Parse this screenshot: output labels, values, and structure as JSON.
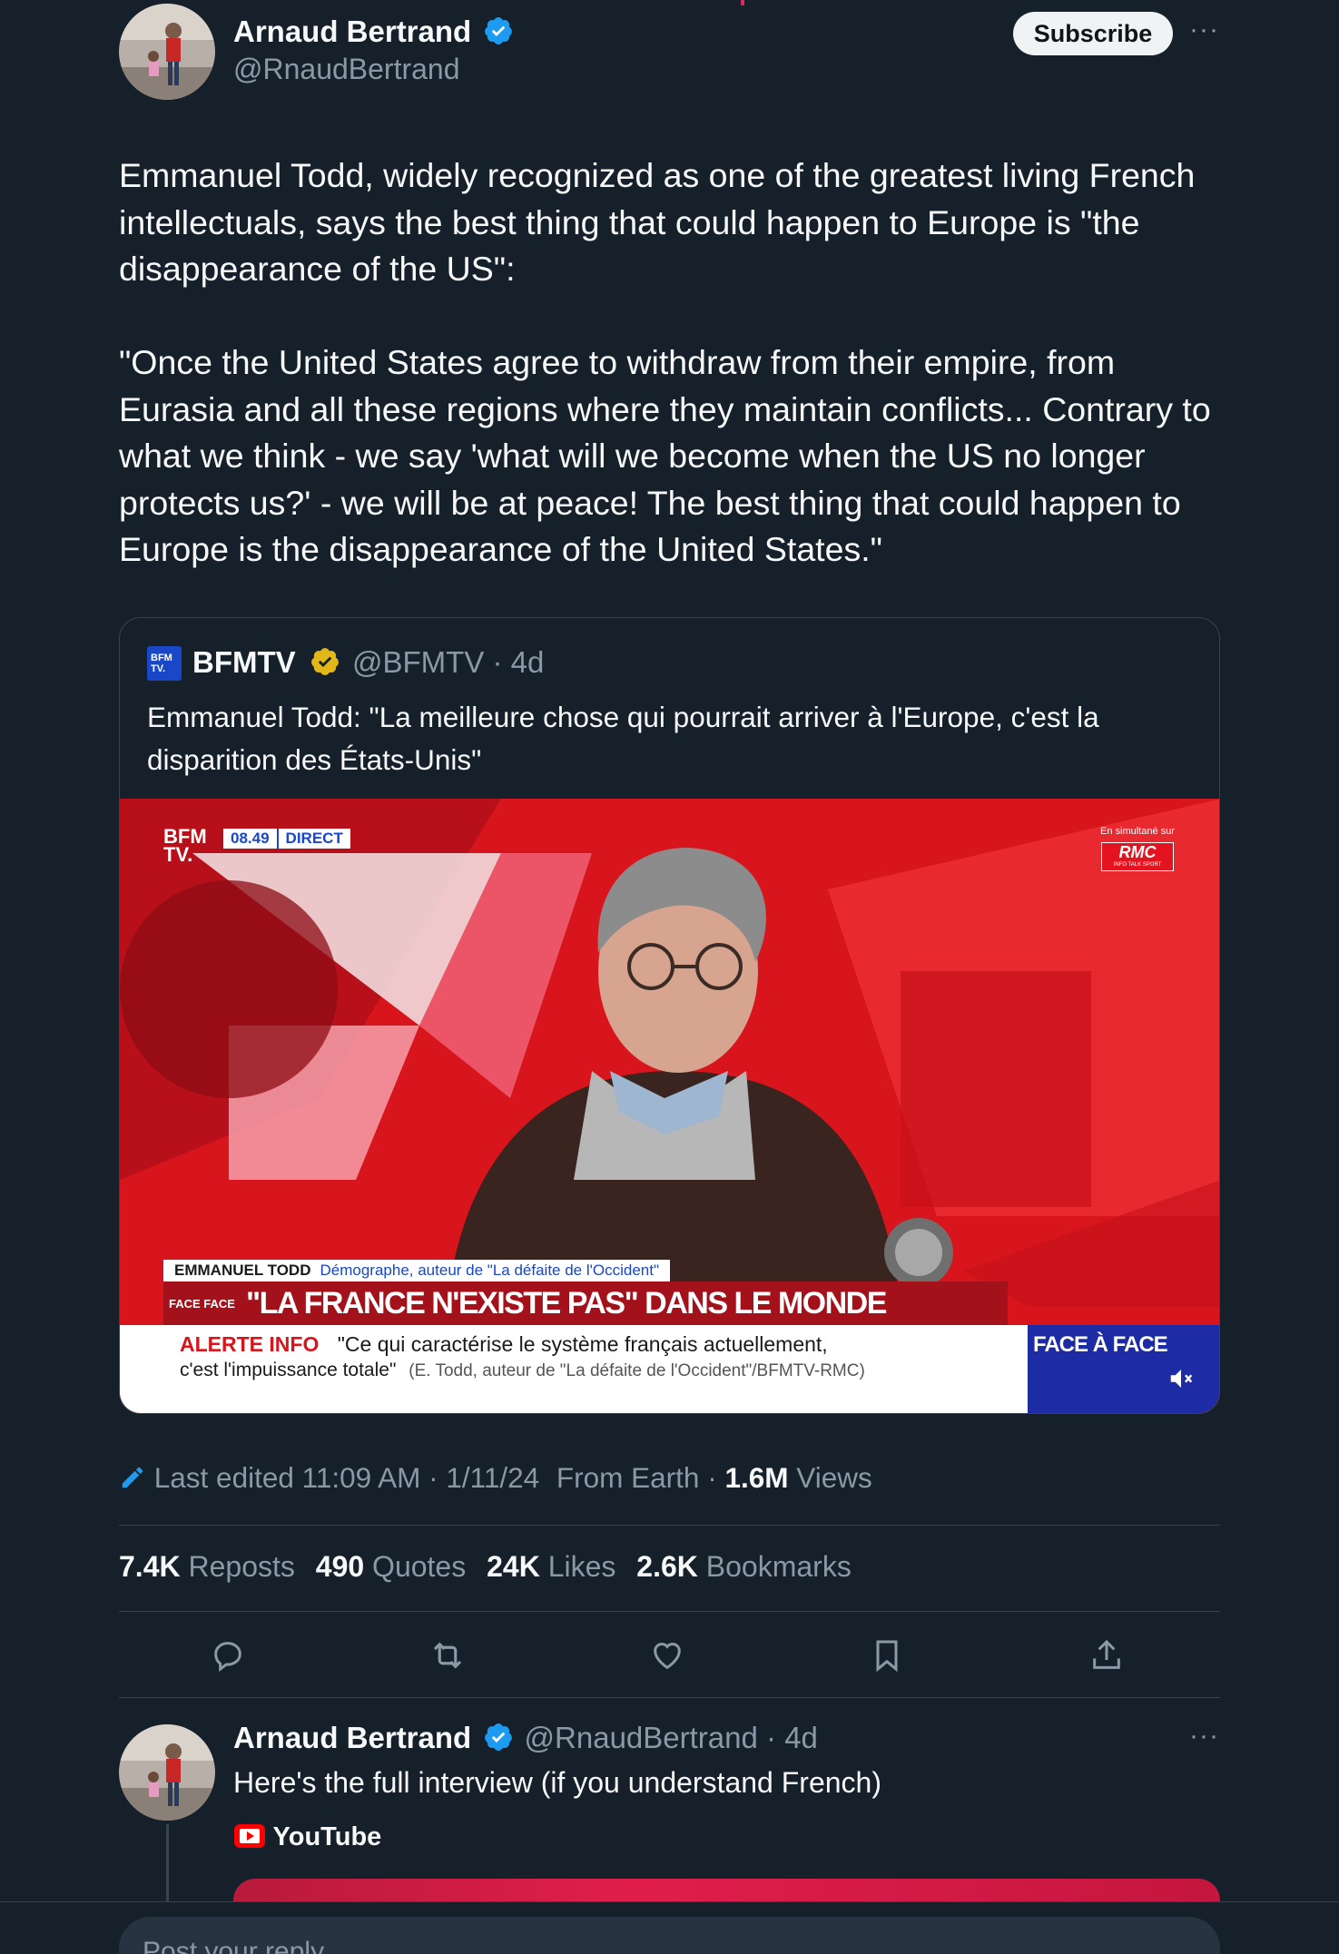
{
  "tweet": {
    "author_name": "Arnaud Bertrand",
    "author_handle": "@RnaudBertrand",
    "subscribe_label": "Subscribe",
    "more_label": "···",
    "body": "Emmanuel Todd, widely recognized as one of the greatest living French intellectuals, says the best thing that could happen to Europe is \"the disappearance of the US\":\n\n\"Once the United States agree to withdraw from their empire, from Eurasia and all these regions where they maintain conflicts... Contrary to what we think - we say 'what will we become when the US no longer protects us?' - we will be at peace! The best thing that could happen to Europe is the disappearance of the United States.\""
  },
  "quote": {
    "logo_text": "BFM TV.",
    "name": "BFMTV",
    "handle": "@BFMTV",
    "time": "· 4d",
    "text": "Emmanuel Todd: \"La meilleure chose qui pourrait arriver à l'Europe, c'est la disparition des États-Unis\"",
    "video": {
      "channel_logo": "BFM TV.",
      "clock": "08.49",
      "live_label": "DIRECT",
      "simulcast_label": "En simultané sur",
      "simulcast_channel": "RMC",
      "simulcast_tagline": "INFO TALK SPORT",
      "guest_name": "EMMANUEL TODD",
      "guest_title": "Démographe, auteur de \"La défaite de l'Occident\"",
      "show_tag": "FACE FACE",
      "headline": "\"LA FRANCE N'EXISTE PAS\" DANS LE MONDE",
      "alert_label": "ALERTE INFO",
      "alert_quote_1": "\"Ce qui caractérise le système français actuellement,",
      "alert_quote_2": "c'est l'impuissance totale\"",
      "alert_source": "(E. Todd, auteur de \"La défaite de l'Occident\"/BFMTV-RMC)",
      "show_name": "FACE À FACE"
    }
  },
  "meta": {
    "edited": "Last edited 11:09 AM · 1/11/24",
    "location": "From Earth",
    "views_count": "1.6M",
    "views_label": "Views"
  },
  "stats": {
    "reposts_count": "7.4K",
    "reposts_label": "Reposts",
    "quotes_count": "490",
    "quotes_label": "Quotes",
    "likes_count": "24K",
    "likes_label": "Likes",
    "bookmarks_count": "2.6K",
    "bookmarks_label": "Bookmarks"
  },
  "reply": {
    "author_name": "Arnaud Bertrand",
    "author_handle": "@RnaudBertrand",
    "time": "· 4d",
    "more_label": "···",
    "text": "Here's the full interview (if you understand French)",
    "link_source": "YouTube"
  },
  "composer": {
    "placeholder": "Post your reply"
  },
  "colors": {
    "background": "#15202b",
    "accent_blue": "#1d9bf0",
    "muted": "#8b98a5",
    "gold_verified": "#e2b719",
    "border": "#38444d"
  }
}
